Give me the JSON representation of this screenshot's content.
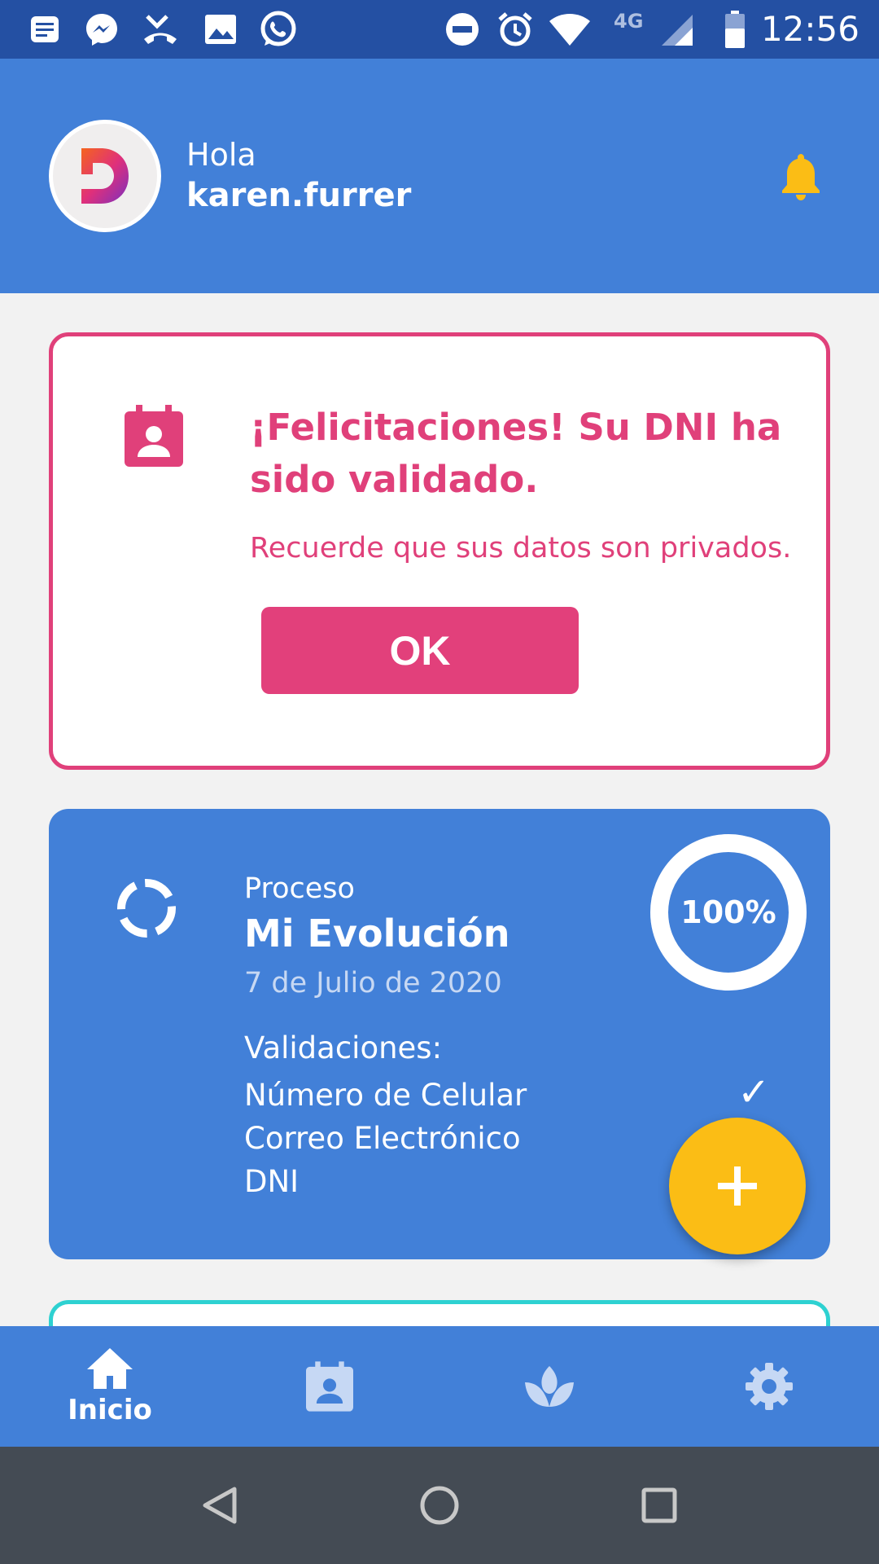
{
  "status_bar": {
    "time": "12:56",
    "network": "4G",
    "left_icons": [
      "notes-icon",
      "messenger-icon",
      "missed-call-icon",
      "image-icon",
      "whatsapp-icon"
    ],
    "right_icons": [
      "dnd-icon",
      "alarm-icon",
      "wifi-icon",
      "signal-icon",
      "battery-icon"
    ]
  },
  "header": {
    "greeting": "Hola",
    "username": "karen.furrer",
    "bell_icon": "bell-icon"
  },
  "validation_card": {
    "title": "¡Felicitaciones! Su DNI ha sido validado.",
    "subtitle": "Recuerde que sus datos son privados.",
    "ok_label": "OK",
    "icon": "contact-calendar-icon"
  },
  "process_card": {
    "label": "Proceso",
    "title": "Mi Evolución",
    "date": "7 de Julio de 2020",
    "progress_text": "100%",
    "progress_value": 1.0,
    "validations_heading": "Validaciones:",
    "validations": [
      "Número de Celular",
      "Correo Electrónico",
      "DNI"
    ],
    "check_mark": "✓"
  },
  "bottom_nav": {
    "items": [
      {
        "label": "Inicio",
        "icon": "home-icon",
        "active": true
      },
      {
        "label": "",
        "icon": "contact-calendar-icon",
        "active": false
      },
      {
        "label": "",
        "icon": "lotus-icon",
        "active": false
      },
      {
        "label": "",
        "icon": "gear-icon",
        "active": false
      }
    ]
  },
  "colors": {
    "header_blue": "#4280d8",
    "status_blue": "#2450a3",
    "pink": "#e0407a",
    "yellow": "#fbbd15",
    "teal": "#2ed1d1"
  }
}
